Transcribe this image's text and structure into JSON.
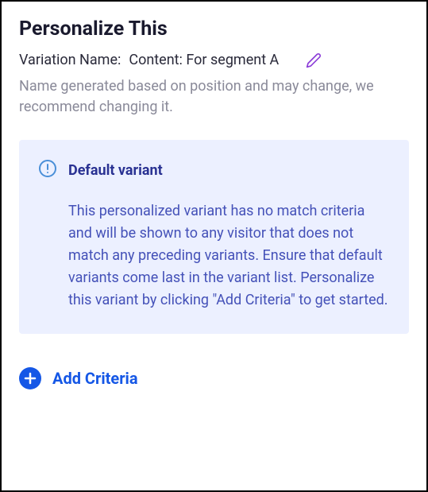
{
  "header": {
    "title": "Personalize This"
  },
  "variation": {
    "label": "Variation Name:",
    "value": "Content: For segment A",
    "helper": "Name generated based on position and may change, we recommend changing it."
  },
  "info_card": {
    "title": "Default variant",
    "body": "This personalized variant has no match criteria and will be shown to any visitor that does not match any preceding variants. Ensure that default variants come last in the variant list. Personalize this variant by clicking \"Add Criteria\" to get started."
  },
  "actions": {
    "add_criteria_label": "Add Criteria"
  }
}
